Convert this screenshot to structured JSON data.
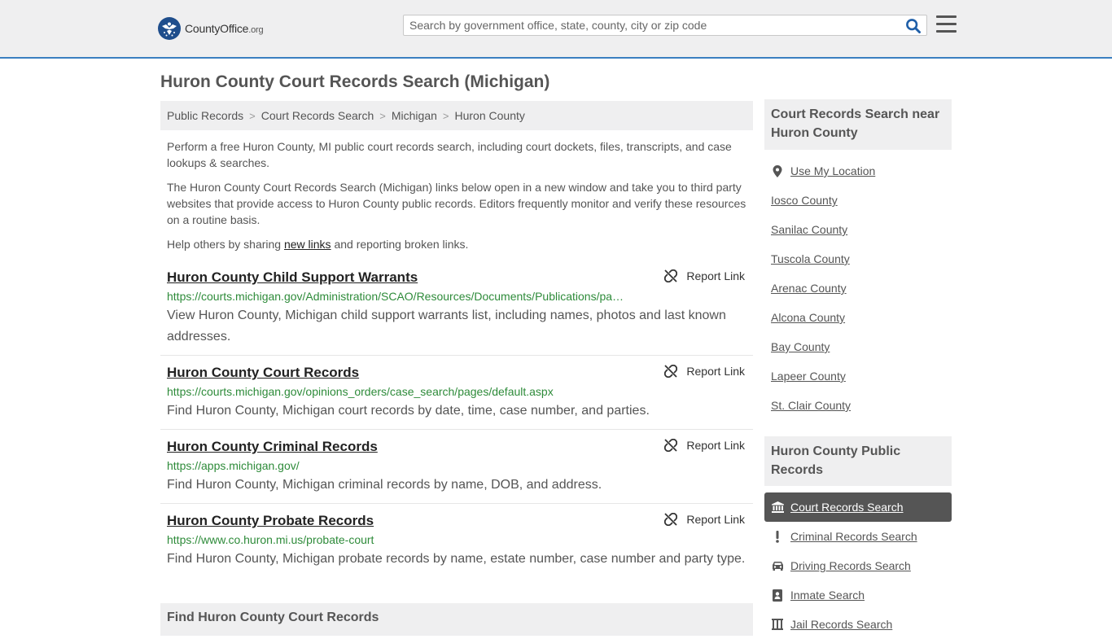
{
  "header": {
    "logo_main": "CountyOffice",
    "logo_suffix": ".org",
    "search_placeholder": "Search by government office, state, county, city or zip code"
  },
  "page_title": "Huron County Court Records Search (Michigan)",
  "breadcrumb": [
    "Public Records",
    "Court Records Search",
    "Michigan",
    "Huron County"
  ],
  "intro": {
    "p1": "Perform a free Huron County, MI public court records search, including court dockets, files, transcripts, and case lookups & searches.",
    "p2": "The Huron County Court Records Search (Michigan) links below open in a new window and take you to third party websites that provide access to Huron County public records. Editors frequently monitor and verify these resources on a routine basis.",
    "p3_before": "Help others by sharing ",
    "p3_link": "new links",
    "p3_after": " and reporting broken links."
  },
  "report_label": "Report Link",
  "records": [
    {
      "title": "Huron County Child Support Warrants",
      "url": "https://courts.michigan.gov/Administration/SCAO/Resources/Documents/Publications/pamphlets/ChildSupportWarrants.pdf",
      "desc": "View Huron County, Michigan child support warrants list, including names, photos and last known addresses."
    },
    {
      "title": "Huron County Court Records",
      "url": "https://courts.michigan.gov/opinions_orders/case_search/pages/default.aspx",
      "desc": "Find Huron County, Michigan court records by date, time, case number, and parties."
    },
    {
      "title": "Huron County Criminal Records",
      "url": "https://apps.michigan.gov/",
      "desc": "Find Huron County, Michigan criminal records by name, DOB, and address."
    },
    {
      "title": "Huron County Probate Records",
      "url": "https://www.co.huron.mi.us/probate-court",
      "desc": "Find Huron County, Michigan probate records by name, estate number, case number and party type."
    }
  ],
  "find_heading": "Find Huron County Court Records",
  "sidebar": {
    "nearby_heading": "Court Records Search near Huron County",
    "use_location": "Use My Location",
    "nearby": [
      "Iosco County",
      "Sanilac County",
      "Tuscola County",
      "Arenac County",
      "Alcona County",
      "Bay County",
      "Lapeer County",
      "St. Clair County"
    ],
    "public_heading": "Huron County Public Records",
    "public_links": [
      {
        "label": "Court Records Search",
        "icon": "courthouse-icon",
        "active": true
      },
      {
        "label": "Criminal Records Search",
        "icon": "exclamation-icon",
        "active": false
      },
      {
        "label": "Driving Records Search",
        "icon": "car-icon",
        "active": false
      },
      {
        "label": "Inmate Search",
        "icon": "id-badge-icon",
        "active": false
      },
      {
        "label": "Jail Records Search",
        "icon": "jail-icon",
        "active": false
      }
    ]
  },
  "colors": {
    "header_bg": "#efeff0",
    "accent_line": "#3a7fc0",
    "logo_blue": "#1f4e8c",
    "search_icon": "#1f5fa8",
    "url_green": "#2e8b3a",
    "active_bg": "#555555"
  }
}
